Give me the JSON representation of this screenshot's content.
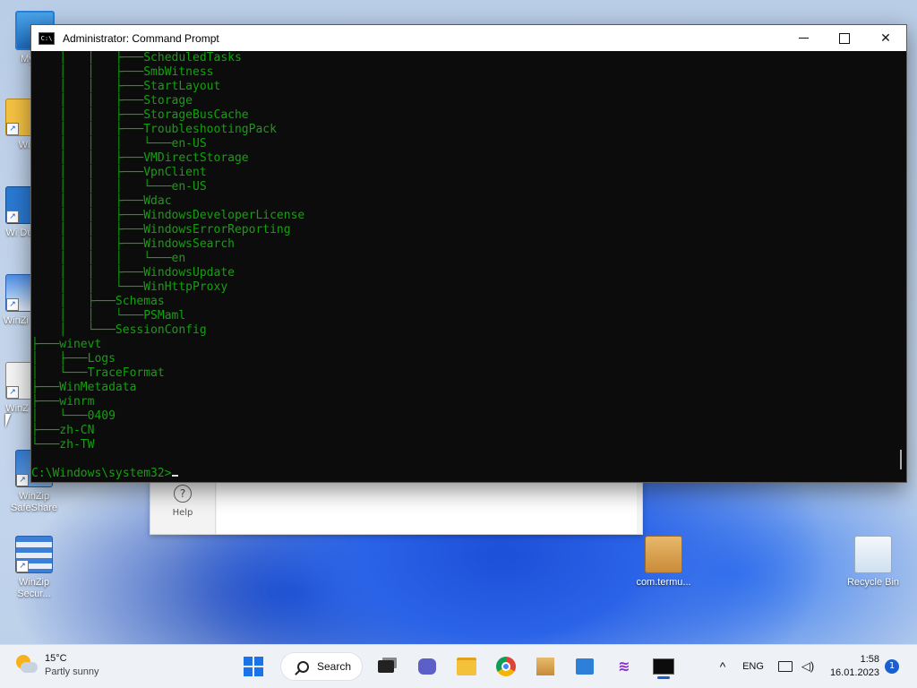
{
  "desktop": {
    "icons": [
      {
        "label": "My Co",
        "icon": "computer-icon"
      },
      {
        "label": "Wi",
        "icon": "winzip-folder-icon"
      },
      {
        "label": "Wi Dupli",
        "icon": "winzip-duplicate-icon"
      },
      {
        "label": "WinZi Ma",
        "icon": "winzip-image-icon"
      },
      {
        "label": "WinZ Ex",
        "icon": "winzip-pdf-icon"
      },
      {
        "label": "WinZip SafeShare",
        "icon": "winzip-safeshare-icon"
      },
      {
        "label": "WinZip Secur...",
        "icon": "winzip-secure-icon"
      },
      {
        "label": "com.termu...",
        "icon": "package-icon"
      },
      {
        "label": "Recycle Bin",
        "icon": "recycle-bin-icon"
      }
    ]
  },
  "background_window": {
    "help_label": "Help"
  },
  "cmd": {
    "title": "Administrator: Command Prompt",
    "lines": [
      "    │   │   ├───ScheduledTasks",
      "    │   │   ├───SmbWitness",
      "    │   │   ├───StartLayout",
      "    │   │   ├───Storage",
      "    │   │   ├───StorageBusCache",
      "    │   │   ├───TroubleshootingPack",
      "    │   │   │   └───en-US",
      "    │   │   ├───VMDirectStorage",
      "    │   │   ├───VpnClient",
      "    │   │   │   └───en-US",
      "    │   │   ├───Wdac",
      "    │   │   ├───WindowsDeveloperLicense",
      "    │   │   ├───WindowsErrorReporting",
      "    │   │   ├───WindowsSearch",
      "    │   │   │   └───en",
      "    │   │   ├───WindowsUpdate",
      "    │   │   └───WinHttpProxy",
      "    │   ├───Schemas",
      "    │   │   └───PSMaml",
      "    │   └───SessionConfig",
      "├───winevt",
      "│   ├───Logs",
      "│   └───TraceFormat",
      "├───WinMetadata",
      "├───winrm",
      "│   └───0409",
      "├───zh-CN",
      "└───zh-TW",
      "",
      "C:\\Windows\\system32>"
    ]
  },
  "taskbar": {
    "weather": {
      "temp": "15°C",
      "condition": "Partly sunny"
    },
    "search_label": "Search",
    "language": "ENG",
    "time": "1:58",
    "date": "16.01.2023",
    "notification_count": "1"
  }
}
